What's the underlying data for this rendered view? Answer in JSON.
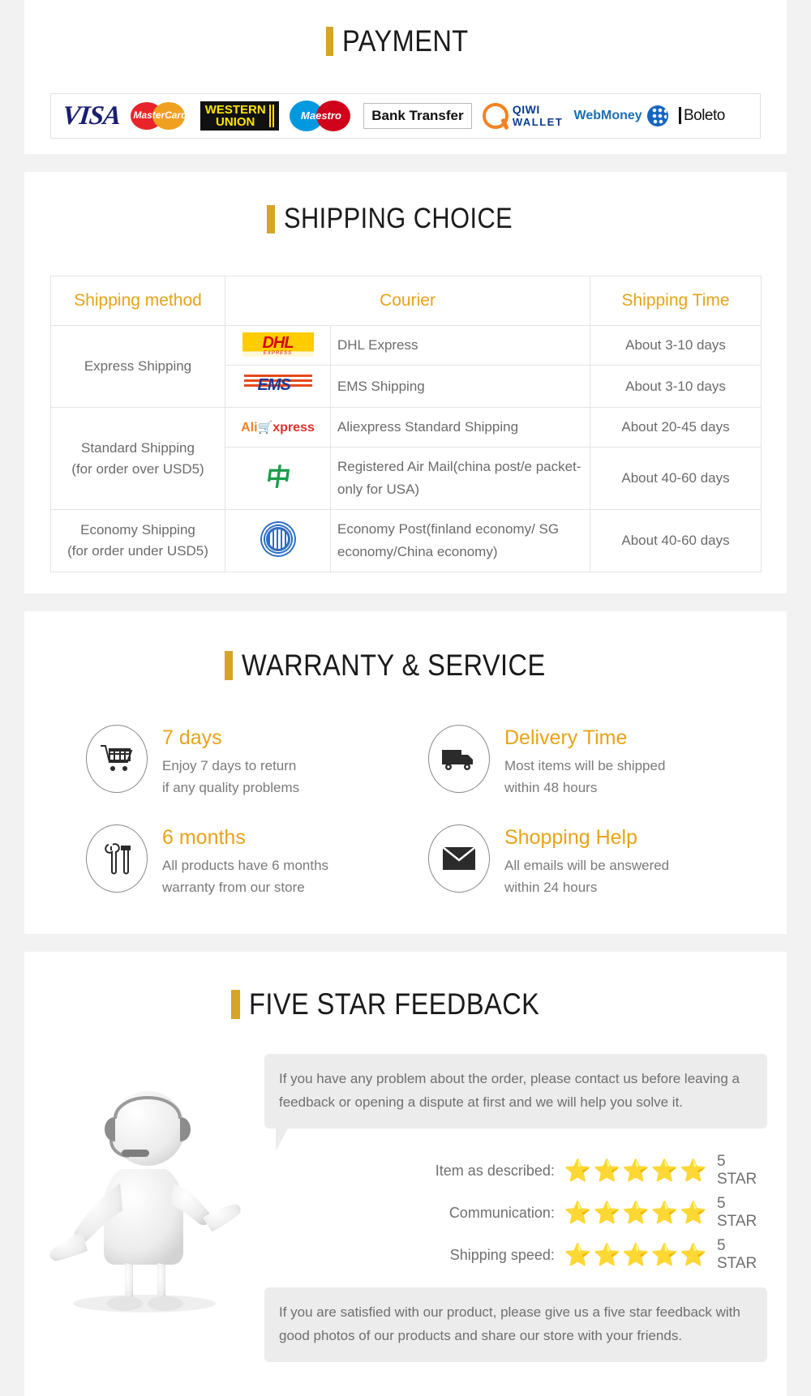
{
  "payment": {
    "title": "PAYMENT",
    "accent": "#d6a429",
    "methods": [
      {
        "name": "visa-logo",
        "label": "VISA"
      },
      {
        "name": "mastercard-logo",
        "label": "MasterCard"
      },
      {
        "name": "western-union-logo",
        "label1": "WESTERN",
        "label2": "UNION"
      },
      {
        "name": "maestro-logo",
        "label": "Maestro"
      },
      {
        "name": "bank-transfer-logo",
        "label": "Bank Transfer"
      },
      {
        "name": "qiwi-wallet-logo",
        "label1": "QIWI",
        "label2": "WALLET"
      },
      {
        "name": "webmoney-logo",
        "label": "WebMoney"
      },
      {
        "name": "boleto-logo",
        "label": "Boleto"
      }
    ]
  },
  "shipping": {
    "title": "SHIPPING CHOICE",
    "headers": [
      "Shipping method",
      "Courier",
      "Shipping Time"
    ],
    "groups": [
      {
        "method": "Express Shipping",
        "method_note": "",
        "rows": [
          {
            "logo": "dhl-logo",
            "logo_text": "DHL",
            "logo_sub": "EXPRESS",
            "courier": "DHL Express",
            "time": "About 3-10 days"
          },
          {
            "logo": "ems-logo",
            "logo_text": "EMS",
            "logo_sub": "",
            "courier": "EMS Shipping",
            "time": "About 3-10 days"
          }
        ]
      },
      {
        "method": "Standard Shipping",
        "method_note": "(for order over USD5)",
        "rows": [
          {
            "logo": "aliexpress-logo",
            "logo_text": "AliExpress",
            "logo_sub": "",
            "courier": "Aliexpress Standard Shipping",
            "time": "About 20-45 days"
          },
          {
            "logo": "china-post-logo",
            "logo_text": "China Post",
            "logo_sub": "",
            "courier": "Registered Air Mail(china post/e packet-only for USA)",
            "time": "About 40-60 days"
          }
        ]
      },
      {
        "method": "Economy Shipping",
        "method_note": "(for order under USD5)",
        "rows": [
          {
            "logo": "un-post-logo",
            "logo_text": "UN",
            "logo_sub": "",
            "courier": "Economy Post(finland economy/ SG economy/China economy)",
            "time": "About 40-60 days"
          }
        ]
      }
    ]
  },
  "warranty": {
    "title": "WARRANTY & SERVICE",
    "items": [
      {
        "icon": "shopping-cart-icon",
        "title": "7 days",
        "lines": [
          "Enjoy 7 days to return",
          "if any quality problems"
        ]
      },
      {
        "icon": "delivery-truck-icon",
        "title": "Delivery Time",
        "lines": [
          "Most items will be shipped",
          "within 48 hours"
        ]
      },
      {
        "icon": "tools-icon",
        "title": "6 months",
        "lines": [
          "All products have 6 months",
          "warranty from our store"
        ]
      },
      {
        "icon": "envelope-icon",
        "title": "Shopping Help",
        "lines": [
          "All emails will be answered",
          "within 24 hours"
        ]
      }
    ]
  },
  "feedback": {
    "title": "FIVE STAR FEEDBACK",
    "bubble_top": "If you have any problem about the order, please contact us before leaving a feedback or opening a dispute at first and we will help you solve it.",
    "ratings": [
      {
        "label": "Item as described:",
        "stars": 5,
        "value": "5 STAR"
      },
      {
        "label": "Communication:",
        "stars": 5,
        "value": "5 STAR"
      },
      {
        "label": "Shipping speed:",
        "stars": 5,
        "value": "5 STAR"
      }
    ],
    "bubble_bottom": "If you are satisfied with our product, please give us a five star feedback with good photos of our products and share our store with your friends.",
    "mascot": "support-agent-figure"
  }
}
